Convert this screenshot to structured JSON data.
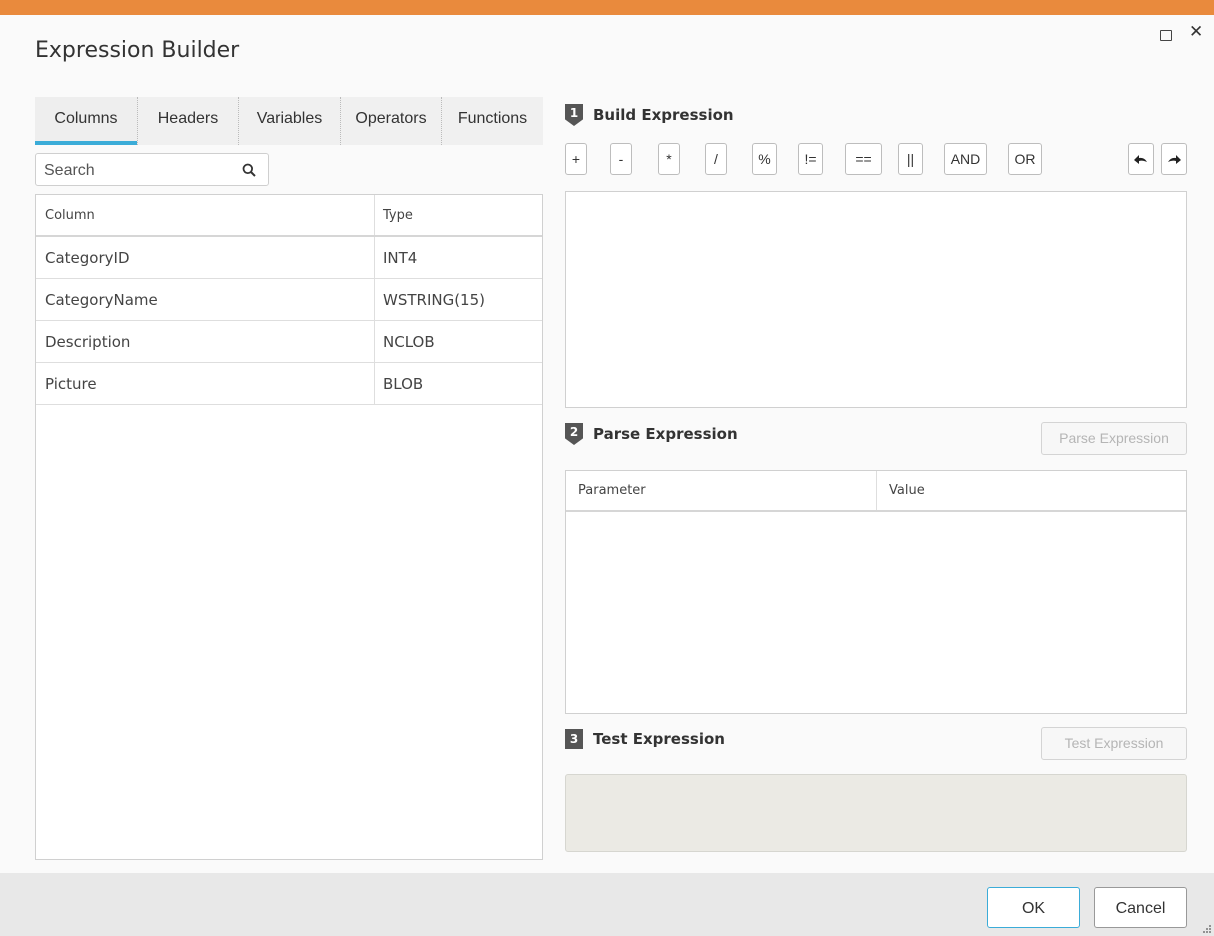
{
  "dialog": {
    "title": "Expression Builder",
    "accent_color": "#e98a3d",
    "tab_indicator_color": "#3bacd8"
  },
  "tabs": [
    {
      "label": "Columns",
      "active": true
    },
    {
      "label": "Headers",
      "active": false
    },
    {
      "label": "Variables",
      "active": false
    },
    {
      "label": "Operators",
      "active": false
    },
    {
      "label": "Functions",
      "active": false
    }
  ],
  "search": {
    "placeholder": "Search",
    "value": ""
  },
  "columns_table": {
    "headers": {
      "column": "Column",
      "type": "Type"
    },
    "rows": [
      {
        "column": "CategoryID",
        "type": "INT4"
      },
      {
        "column": "CategoryName",
        "type": "WSTRING(15)"
      },
      {
        "column": "Description",
        "type": "NCLOB"
      },
      {
        "column": "Picture",
        "type": "BLOB"
      }
    ]
  },
  "build": {
    "step": "1",
    "title": "Build Expression",
    "operators": [
      "+",
      "-",
      "*",
      "/",
      "%",
      "!=",
      "==",
      "||",
      "AND",
      "OR"
    ],
    "expression": ""
  },
  "parse": {
    "step": "2",
    "title": "Parse Expression",
    "button_label": "Parse Expression",
    "headers": {
      "parameter": "Parameter",
      "value": "Value"
    }
  },
  "test": {
    "step": "3",
    "title": "Test Expression",
    "button_label": "Test Expression",
    "output": ""
  },
  "footer": {
    "ok_label": "OK",
    "cancel_label": "Cancel"
  }
}
